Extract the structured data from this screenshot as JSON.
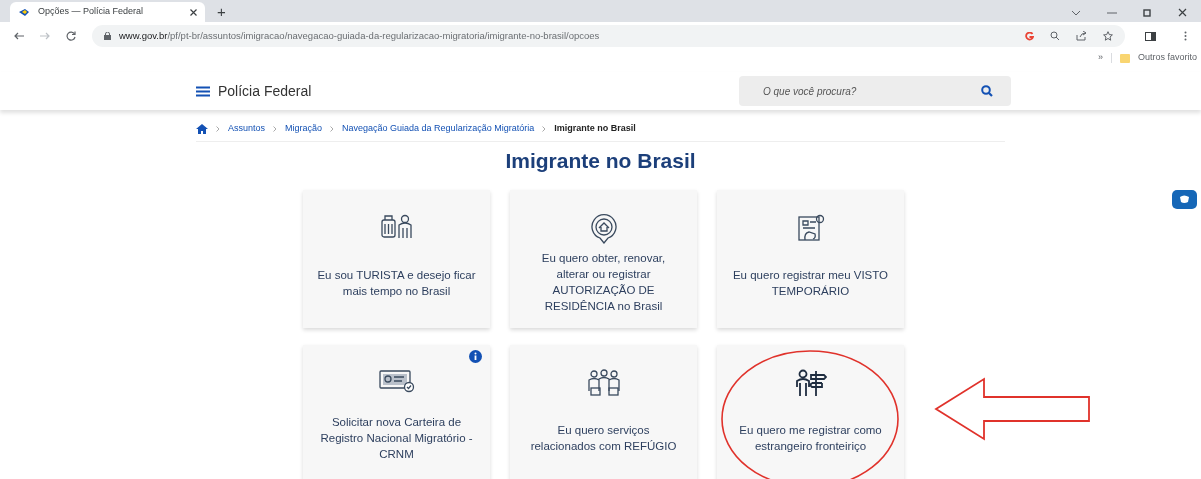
{
  "browser": {
    "tab": {
      "title": "Opções — Polícia Federal",
      "selected": true
    },
    "new_tab": "+",
    "url_host": "www.gov.br",
    "url_path": "/pf/pt-br/assuntos/imigracao/navegacao-guiada-da-regularizacao-migratoria/imigrante-no-brasil/opcoes",
    "bookmarks_more": "»",
    "bookmark_folder": "Outros favorito"
  },
  "header": {
    "site_name": "Polícia Federal",
    "search": {
      "placeholder": "O que você procura?"
    }
  },
  "breadcrumb": [
    {
      "label": "Assuntos",
      "current": false
    },
    {
      "label": "Migração",
      "current": false
    },
    {
      "label": "Navegação Guiada da Regularização Migratória",
      "current": false
    },
    {
      "label": "Imigrante no Brasil",
      "current": true
    }
  ],
  "title": "Imigrante no Brasil",
  "cards": [
    {
      "text": "Eu sou TURISTA e desejo ficar mais tempo no Brasil",
      "info": false,
      "highlighted": false
    },
    {
      "text": "Eu quero obter, renovar, alterar ou registrar AUTORIZAÇÃO DE RESIDÊNCIA no Brasil",
      "info": false,
      "highlighted": false
    },
    {
      "text": "Eu quero registrar meu VISTO TEMPORÁRIO",
      "info": false,
      "highlighted": false
    },
    {
      "text": "Solicitar nova Carteira de Registro Nacional Migratório - CRNM",
      "info": true,
      "highlighted": false
    },
    {
      "text": "Eu quero serviços relacionados com REFÚGIO",
      "info": false,
      "highlighted": false
    },
    {
      "text": "Eu quero me registrar como estrangeiro fronteiriço",
      "info": false,
      "highlighted": true
    }
  ]
}
